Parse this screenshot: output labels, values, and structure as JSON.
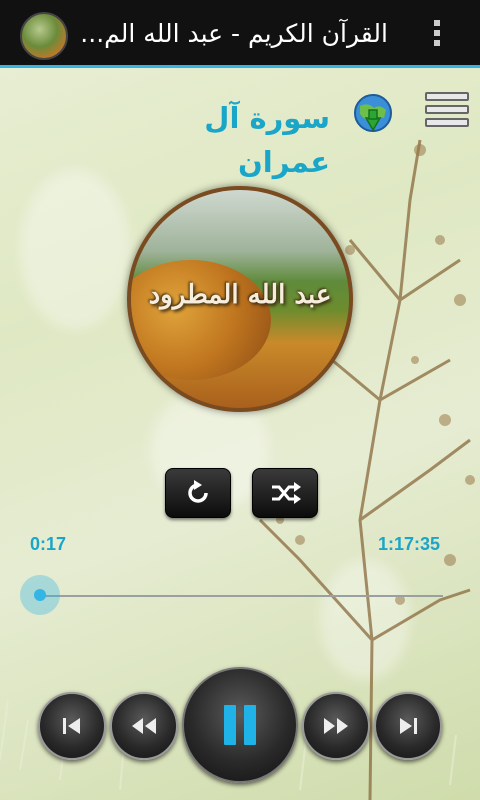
{
  "app_bar": {
    "title": "القرآن الكريم - عبد الله الم...",
    "app_icon": "app-logo-icon",
    "overflow_icon": "overflow-menu-icon"
  },
  "player": {
    "surah_title": "سورة آل عمران",
    "reciter_label": "عبد الله المطرود",
    "elapsed": "0:17",
    "duration": "1:17:35",
    "progress": 0.004,
    "icons": {
      "download": "globe-download-icon",
      "playlist": "playlist-icon",
      "repeat": "repeat-icon",
      "shuffle": "shuffle-icon",
      "previous": "skip-previous-icon",
      "rewind": "rewind-icon",
      "pause": "pause-icon",
      "forward": "fast-forward-icon",
      "next": "skip-next-icon"
    }
  },
  "colors": {
    "accent": "#33b5e5",
    "title_text": "#1aa6c8",
    "action_bar": "#111111"
  }
}
